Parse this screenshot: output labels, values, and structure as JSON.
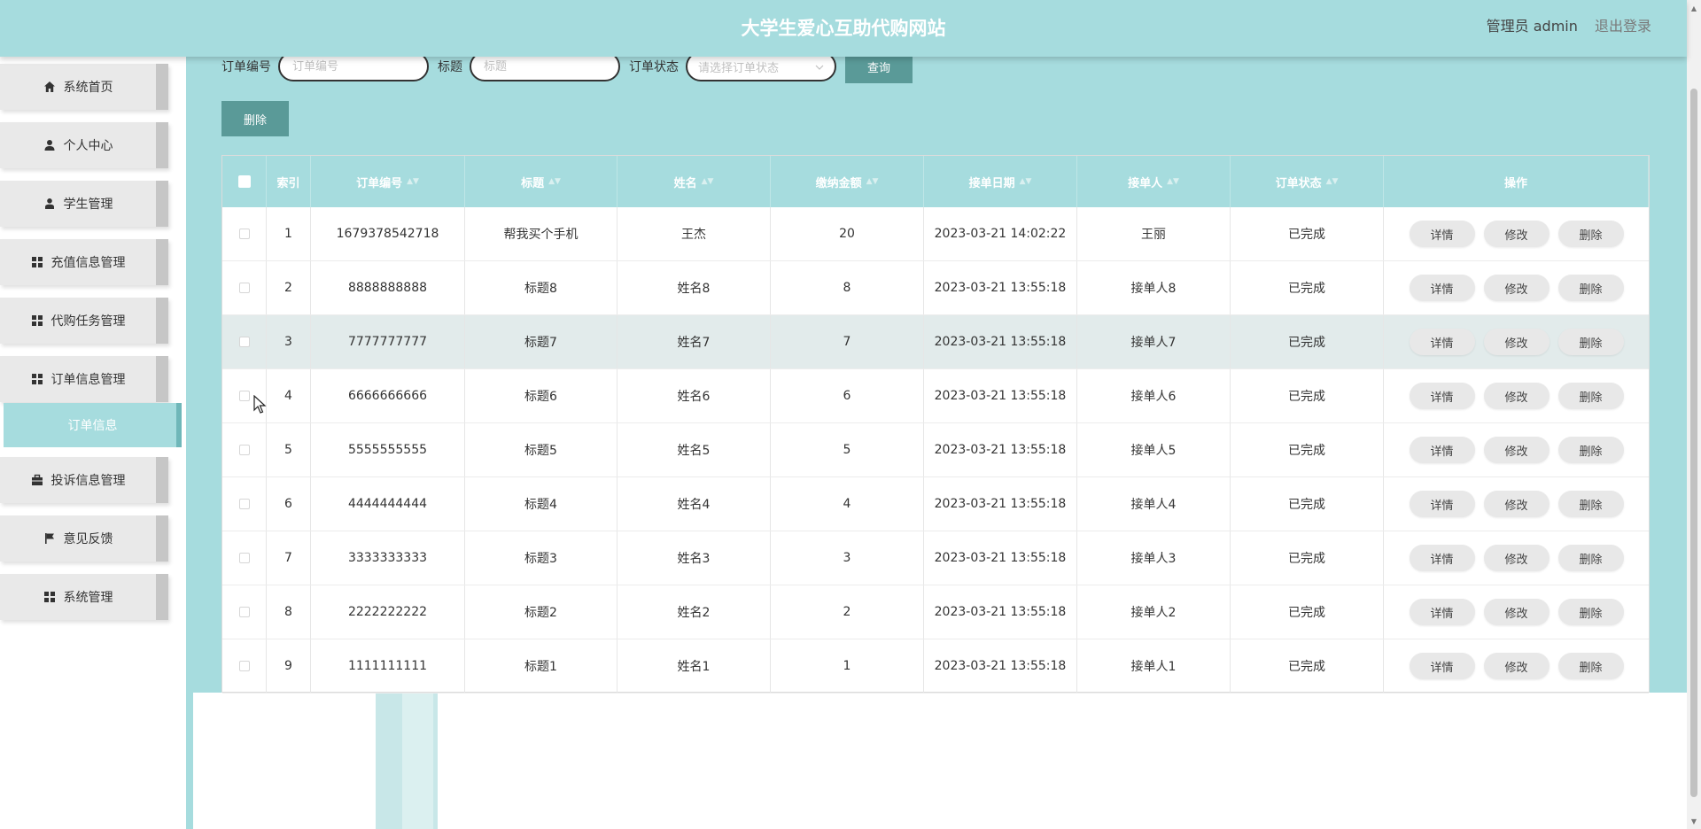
{
  "header": {
    "title": "大学生爱心互助代购网站",
    "user_label": "管理员 admin",
    "logout_label": "退出登录"
  },
  "sidebar": {
    "items": [
      {
        "label": "系统首页",
        "icon": "home-icon"
      },
      {
        "label": "个人中心",
        "icon": "person-icon"
      },
      {
        "label": "学生管理",
        "icon": "user-icon"
      },
      {
        "label": "充值信息管理",
        "icon": "grid-icon"
      },
      {
        "label": "代购任务管理",
        "icon": "grid-icon"
      },
      {
        "label": "订单信息管理",
        "icon": "grid-icon"
      },
      {
        "label": "投诉信息管理",
        "icon": "briefcase-icon"
      },
      {
        "label": "意见反馈",
        "icon": "flag-icon"
      },
      {
        "label": "系统管理",
        "icon": "grid-icon"
      }
    ],
    "active_sub": "订单信息"
  },
  "search": {
    "order_no_label": "订单编号",
    "order_no_placeholder": "订单编号",
    "title_label": "标题",
    "title_placeholder": "标题",
    "status_label": "订单状态",
    "status_placeholder": "请选择订单状态",
    "query_label": "查询"
  },
  "toolbar": {
    "delete_label": "删除"
  },
  "table": {
    "columns": [
      "索引",
      "订单编号",
      "标题",
      "姓名",
      "缴纳金额",
      "接单日期",
      "接单人",
      "订单状态",
      "操作"
    ],
    "rows": [
      {
        "idx": "1",
        "order_no": "1679378542718",
        "title": "帮我买个手机",
        "name": "王杰",
        "amount": "20",
        "date": "2023-03-21 14:02:22",
        "taker": "王丽",
        "status": "已完成"
      },
      {
        "idx": "2",
        "order_no": "8888888888",
        "title": "标题8",
        "name": "姓名8",
        "amount": "8",
        "date": "2023-03-21 13:55:18",
        "taker": "接单人8",
        "status": "已完成"
      },
      {
        "idx": "3",
        "order_no": "7777777777",
        "title": "标题7",
        "name": "姓名7",
        "amount": "7",
        "date": "2023-03-21 13:55:18",
        "taker": "接单人7",
        "status": "已完成"
      },
      {
        "idx": "4",
        "order_no": "6666666666",
        "title": "标题6",
        "name": "姓名6",
        "amount": "6",
        "date": "2023-03-21 13:55:18",
        "taker": "接单人6",
        "status": "已完成"
      },
      {
        "idx": "5",
        "order_no": "5555555555",
        "title": "标题5",
        "name": "姓名5",
        "amount": "5",
        "date": "2023-03-21 13:55:18",
        "taker": "接单人5",
        "status": "已完成"
      },
      {
        "idx": "6",
        "order_no": "4444444444",
        "title": "标题4",
        "name": "姓名4",
        "amount": "4",
        "date": "2023-03-21 13:55:18",
        "taker": "接单人4",
        "status": "已完成"
      },
      {
        "idx": "7",
        "order_no": "3333333333",
        "title": "标题3",
        "name": "姓名3",
        "amount": "3",
        "date": "2023-03-21 13:55:18",
        "taker": "接单人3",
        "status": "已完成"
      },
      {
        "idx": "8",
        "order_no": "2222222222",
        "title": "标题2",
        "name": "姓名2",
        "amount": "2",
        "date": "2023-03-21 13:55:18",
        "taker": "接单人2",
        "status": "已完成"
      },
      {
        "idx": "9",
        "order_no": "1111111111",
        "title": "标题1",
        "name": "姓名1",
        "amount": "1",
        "date": "2023-03-21 13:55:18",
        "taker": "接单人1",
        "status": "已完成"
      }
    ],
    "actions": {
      "detail": "详情",
      "edit": "修改",
      "delete": "删除"
    }
  }
}
